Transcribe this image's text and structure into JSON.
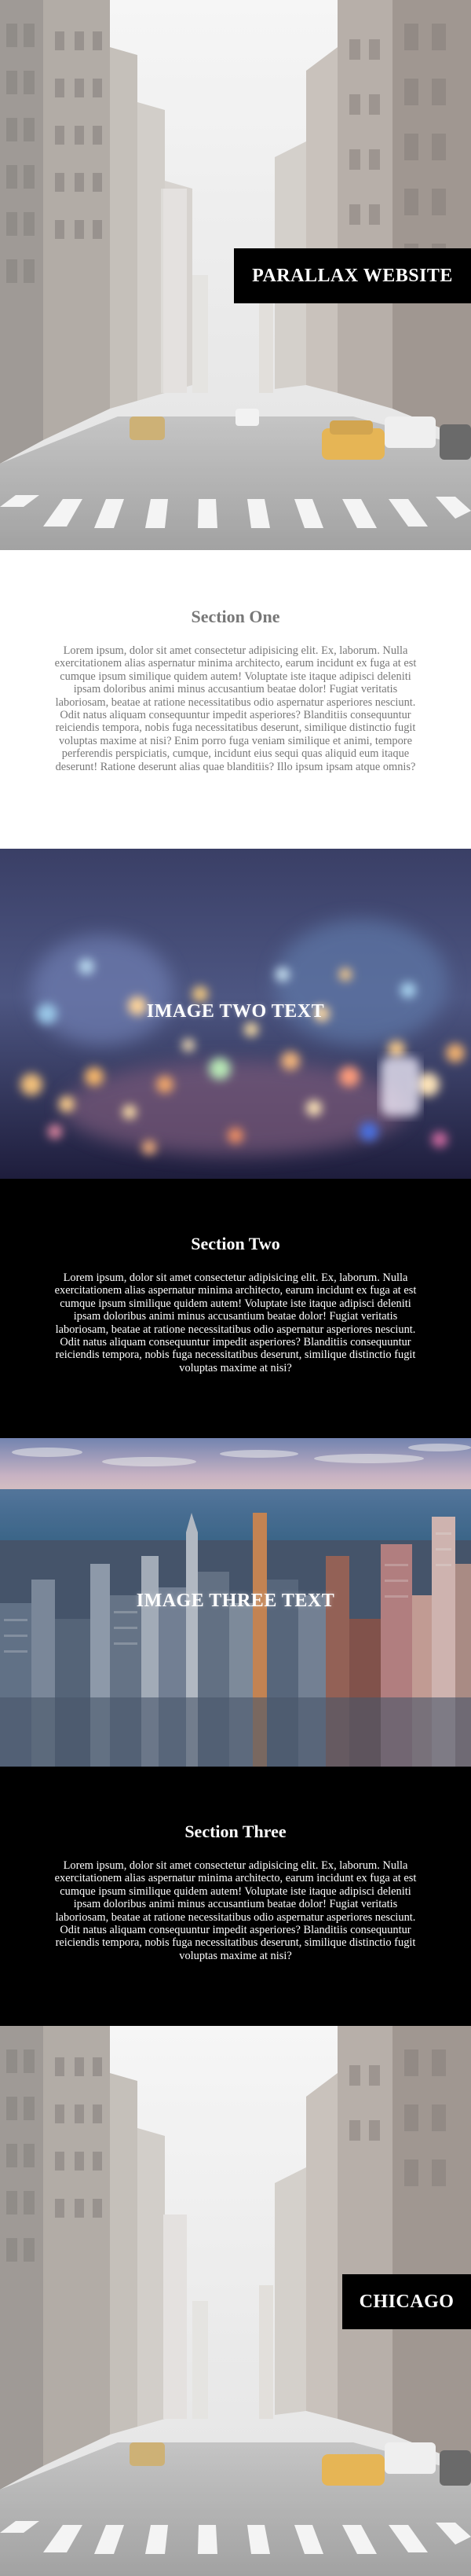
{
  "hero": {
    "caption": "PARALLAX WEBSITE"
  },
  "section_one": {
    "heading": "Section One",
    "body": "Lorem ipsum, dolor sit amet consectetur adipisicing elit. Ex, laborum. Nulla exercitationem alias aspernatur minima architecto, earum incidunt ex fuga at est cumque ipsum similique quidem autem! Voluptate iste itaque adipisci deleniti ipsam doloribus animi minus accusantium beatae dolor! Fugiat veritatis laboriosam, beatae at ratione necessitatibus odio aspernatur asperiores nesciunt. Odit natus aliquam consequuntur impedit asperiores? Blanditiis consequuntur reiciendis tempora, nobis fuga necessitatibus deserunt, similique distinctio fugit voluptas maxime at nisi? Enim porro fuga veniam similique et animi, tempore perferendis perspiciatis, cumque, incidunt eius sequi quas aliquid eum itaque deserunt! Ratione deserunt alias quae blanditiis? Illo ipsum ipsam atque omnis?"
  },
  "image_two": {
    "caption": "IMAGE TWO TEXT"
  },
  "section_two": {
    "heading": "Section Two",
    "body": "Lorem ipsum, dolor sit amet consectetur adipisicing elit. Ex, laborum. Nulla exercitationem alias aspernatur minima architecto, earum incidunt ex fuga at est cumque ipsum similique quidem autem! Voluptate iste itaque adipisci deleniti ipsam doloribus animi minus accusantium beatae dolor! Fugiat veritatis laboriosam, beatae at ratione necessitatibus odio aspernatur asperiores nesciunt. Odit natus aliquam consequuntur impedit asperiores? Blanditiis consequuntur reiciendis tempora, nobis fuga necessitatibus deserunt, similique distinctio fugit voluptas maxime at nisi?"
  },
  "image_three": {
    "caption": "IMAGE THREE TEXT"
  },
  "section_three": {
    "heading": "Section Three",
    "body": "Lorem ipsum, dolor sit amet consectetur adipisicing elit. Ex, laborum. Nulla exercitationem alias aspernatur minima architecto, earum incidunt ex fuga at est cumque ipsum similique quidem autem! Voluptate iste itaque adipisci deleniti ipsam doloribus animi minus accusantium beatae dolor! Fugiat veritatis laboriosam, beatae at ratione necessitatibus odio aspernatur asperiores nesciunt. Odit natus aliquam consequuntur impedit asperiores? Blanditiis consequuntur reiciendis tempora, nobis fuga necessitatibus deserunt, similique distinctio fugit voluptas maxime at nisi?"
  },
  "footer_image": {
    "caption": "CHICAGO"
  },
  "colors": {
    "dark": "#000000",
    "light_text": "#777777"
  }
}
